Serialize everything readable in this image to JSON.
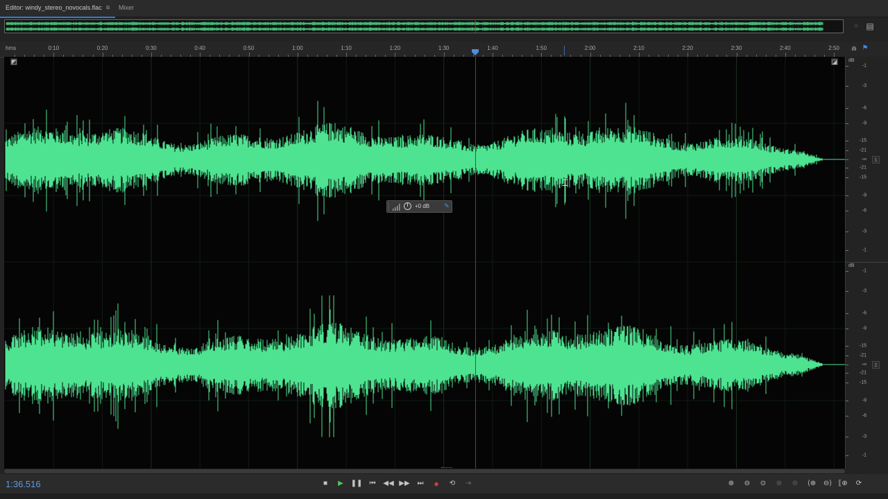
{
  "tabs": {
    "editor_label": "Editor: windy_stereo_novocals.flac",
    "editor_menu_icon": "hamburger-menu-icon",
    "mixer_label": "Mixer"
  },
  "ruler": {
    "unit": "hms",
    "ticks": [
      "0:10",
      "0:20",
      "0:30",
      "0:40",
      "0:50",
      "1:00",
      "1:10",
      "1:20",
      "1:30",
      "1:40",
      "1:50",
      "2:00",
      "2:10",
      "2:20",
      "2:30",
      "2:40",
      "2:50"
    ]
  },
  "db_scale": {
    "unit": "dB",
    "channel1_label": "1",
    "channel2_label": "2",
    "labels": [
      "-1",
      "-3",
      "-6",
      "-9",
      "-15",
      "-21",
      "-∞",
      "-21",
      "-15",
      "-9",
      "-6",
      "-3",
      "-1"
    ]
  },
  "hud": {
    "volume_value": "+0 dB"
  },
  "transport": {
    "timecode": "1:36.516",
    "buttons": [
      "stop",
      "play",
      "pause",
      "move-to-previous",
      "rewind",
      "fast-forward",
      "move-to-next",
      "record",
      "loop",
      "skip-selection"
    ],
    "zoom_buttons": [
      "zoom-in-amplitude",
      "zoom-out-amplitude",
      "zoom-reset",
      "zoom-in-at-playhead",
      "zoom-out-full",
      "zoom-in-time",
      "zoom-out-time",
      "zoom-to-selection",
      "zoom-full"
    ]
  },
  "colors": {
    "waveform": "#4ee391",
    "playhead": "#b3221d",
    "accent": "#5c9ae6",
    "record": "#e23b3b"
  }
}
